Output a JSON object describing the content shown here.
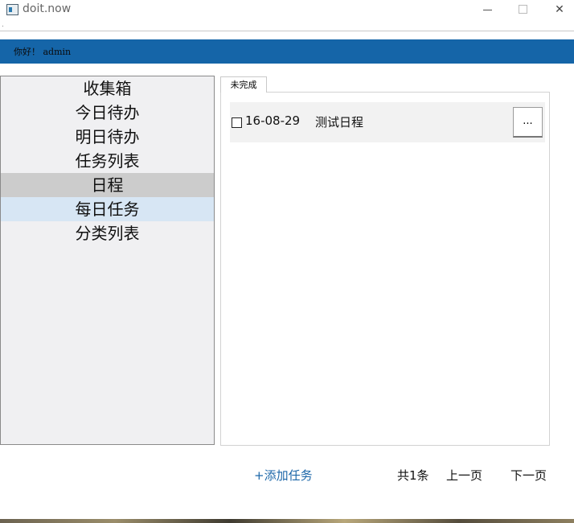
{
  "window": {
    "title": "doit.now",
    "minimize_glyph": "",
    "maximize_glyph": "",
    "close_glyph": "✕",
    "menu_hint": "."
  },
  "header": {
    "greeting": "你好！ admin",
    "background_color": "#1565a8"
  },
  "sidebar": {
    "items": [
      {
        "label": "收集箱"
      },
      {
        "label": "今日待办"
      },
      {
        "label": "明日待办"
      },
      {
        "label": "任务列表"
      },
      {
        "label": "日程"
      },
      {
        "label": "每日任务"
      },
      {
        "label": "分类列表"
      }
    ],
    "selected": "日程",
    "hovered": "每日任务"
  },
  "main": {
    "tabs": [
      {
        "label": "未完成"
      }
    ],
    "tasks": [
      {
        "checked": false,
        "date": "16-08-29",
        "name": "测试日程",
        "more_label": "..."
      }
    ]
  },
  "footer": {
    "add_task": "+添加任务",
    "count": "共1条",
    "prev": "上一页",
    "next": "下一页",
    "add_color": "#1b66a8"
  }
}
